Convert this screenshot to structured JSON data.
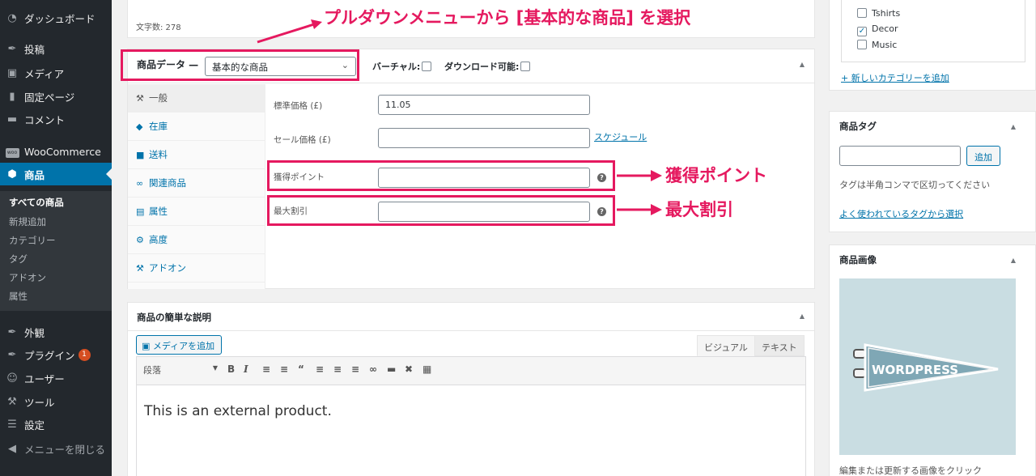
{
  "sidebar": {
    "menu": [
      {
        "icon": "dashboard-icon",
        "glyph": "◔",
        "label": "ダッシュボード"
      },
      {
        "icon": "pin-icon",
        "glyph": "✒",
        "label": "投稿"
      },
      {
        "icon": "media-icon",
        "glyph": "▣",
        "label": "メディア"
      },
      {
        "icon": "page-icon",
        "glyph": "▮",
        "label": "固定ページ"
      },
      {
        "icon": "comment-icon",
        "glyph": "▬",
        "label": "コメント"
      },
      {
        "icon": "woocommerce-icon",
        "glyph": "woo",
        "label": "WooCommerce"
      },
      {
        "icon": "products-icon",
        "glyph": "⬢",
        "label": "商品"
      }
    ],
    "submenu": [
      "すべての商品",
      "新規追加",
      "カテゴリー",
      "タグ",
      "アドオン",
      "属性"
    ],
    "menu2": [
      {
        "icon": "appearance-icon",
        "glyph": "✒",
        "label": "外観"
      },
      {
        "icon": "plugin-icon",
        "glyph": "✒",
        "label": "プラグイン",
        "badge": "1"
      },
      {
        "icon": "user-icon",
        "glyph": "☺",
        "label": "ユーザー"
      },
      {
        "icon": "tools-icon",
        "glyph": "⚒",
        "label": "ツール"
      },
      {
        "icon": "settings-icon",
        "glyph": "☰",
        "label": "設定"
      },
      {
        "icon": "collapse-icon",
        "glyph": "◀",
        "label": "メニューを閉じる"
      }
    ]
  },
  "editor_top": {
    "word_count": "文字数: 278"
  },
  "product_data": {
    "title": "商品データ —",
    "type_select": "基本的な商品",
    "virtual_label": "バーチャル:",
    "downloadable_label": "ダウンロード可能:",
    "tabs": [
      {
        "icon": "wrench-icon",
        "glyph": "⚒",
        "label": "一般"
      },
      {
        "icon": "inventory-icon",
        "glyph": "◆",
        "label": "在庫"
      },
      {
        "icon": "truck-icon",
        "glyph": "■",
        "label": "送料"
      },
      {
        "icon": "link-icon",
        "glyph": "∞",
        "label": "関連商品"
      },
      {
        "icon": "attributes-icon",
        "glyph": "▤",
        "label": "属性"
      },
      {
        "icon": "gear-icon",
        "glyph": "⚙",
        "label": "高度"
      },
      {
        "icon": "wrench-icon",
        "glyph": "⚒",
        "label": "アドオン"
      }
    ],
    "fields": {
      "regular_price_label": "標準価格 (£)",
      "regular_price_value": "11.05",
      "sale_price_label": "セール価格 (£)",
      "sale_price_value": "",
      "schedule_link": "スケジュール",
      "points_label": "獲得ポイント",
      "points_value": "",
      "max_discount_label": "最大割引",
      "max_discount_value": ""
    }
  },
  "short_description": {
    "title": "商品の簡単な説明",
    "add_media": "メディアを追加",
    "tab_visual": "ビジュアル",
    "tab_text": "テキスト",
    "format_select": "段落",
    "content": "This is an external product."
  },
  "categories": {
    "items": [
      {
        "label": "Tshirts",
        "checked": false
      },
      {
        "label": "Decor",
        "checked": true
      },
      {
        "label": "Music",
        "checked": false
      }
    ],
    "add_link": "+ 新しいカテゴリーを追加"
  },
  "tags": {
    "title": "商品タグ",
    "add_button": "追加",
    "help": "タグは半角コンマで区切ってください",
    "popular_link": "よく使われているタグから選択"
  },
  "product_image": {
    "title": "商品画像",
    "image_text": "WORDPRESS",
    "caption": "編集または更新する画像をクリック"
  },
  "annotations": {
    "top": "プルダウンメニューから [基本的な商品] を選択",
    "points": "獲得ポイント",
    "discount": "最大割引"
  },
  "colors": {
    "annotation": "#e5195f",
    "admin_blue": "#0073aa",
    "sidebar": "#23282d"
  }
}
